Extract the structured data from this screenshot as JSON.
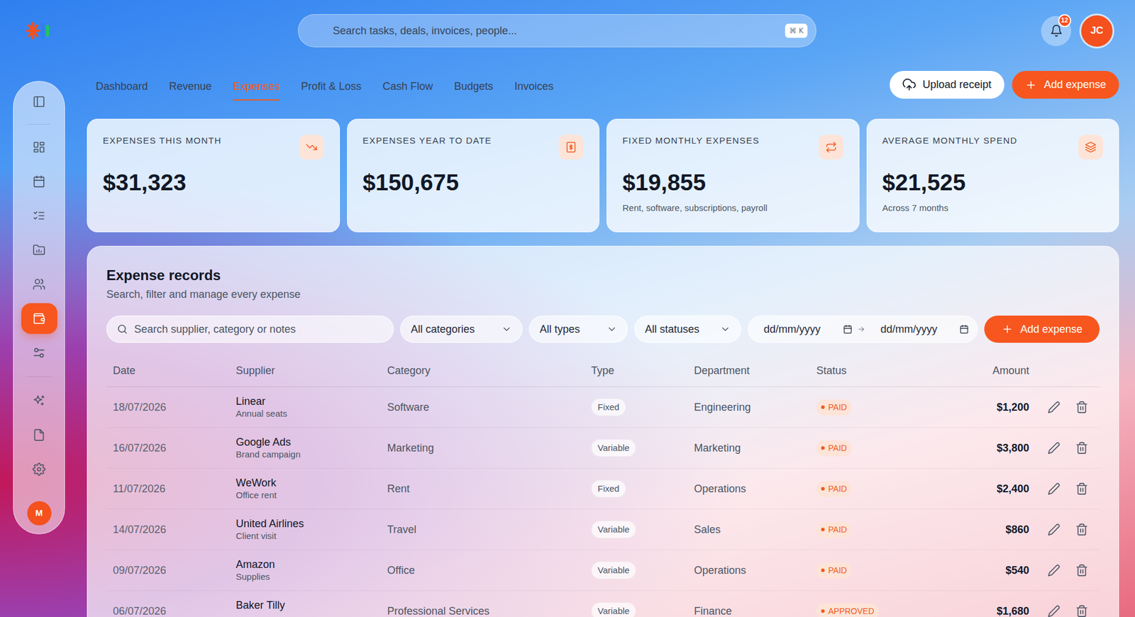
{
  "search": {
    "placeholder": "Search tasks, deals, invoices, people...",
    "shortcut": "⌘ K"
  },
  "notifications": {
    "count": "12"
  },
  "user": {
    "initials": "JC"
  },
  "sidebar": {
    "nav": [
      {
        "selected": false
      },
      {
        "selected": false
      },
      {
        "selected": false
      },
      {
        "selected": false
      },
      {
        "selected": false
      },
      {
        "selected": true
      },
      {
        "selected": false
      }
    ],
    "tools": [
      {
        "selected": false
      },
      {
        "selected": false
      },
      {
        "selected": false
      }
    ],
    "avatar": "M"
  },
  "tabs": [
    {
      "label": "Dashboard",
      "selected": false
    },
    {
      "label": "Revenue",
      "selected": false
    },
    {
      "label": "Expenses",
      "selected": true
    },
    {
      "label": "Profit & Loss",
      "selected": false
    },
    {
      "label": "Cash Flow",
      "selected": false
    },
    {
      "label": "Budgets",
      "selected": false
    },
    {
      "label": "Invoices",
      "selected": false
    }
  ],
  "actions": [
    {
      "label": "Upload receipt",
      "kind": "secondary"
    },
    {
      "label": "Add expense",
      "kind": "primary"
    }
  ],
  "stats": [
    {
      "label": "EXPENSES THIS MONTH",
      "value": "$31,323"
    },
    {
      "label": "EXPENSES YEAR TO DATE",
      "value": "$150,675"
    },
    {
      "label": "FIXED MONTHLY EXPENSES",
      "value": "$19,855",
      "note": "Rent, software, subscriptions, payroll"
    },
    {
      "label": "AVERAGE MONTHLY SPEND",
      "value": "$21,525",
      "note": "Across 7 months"
    }
  ],
  "records": {
    "title": "Expense records",
    "subtitle": "Search, filter and manage every expense",
    "search_placeholder": "Search supplier, category or notes",
    "filters": [
      "All categories",
      "All types",
      "All statuses"
    ],
    "date_from": "dd/mm/yyyy",
    "date_to": "dd/mm/yyyy",
    "add_label": "Add expense"
  },
  "table": {
    "columns": [
      "Date",
      "Supplier",
      "Category",
      "Type",
      "Department",
      "Status",
      "Amount"
    ],
    "rows": [
      {
        "date": "18/07/2026",
        "supplier": "Linear",
        "note": "Annual seats",
        "category": "Software",
        "type": "Fixed",
        "department": "Engineering",
        "status": "PAID",
        "amount": "$1,200"
      },
      {
        "date": "16/07/2026",
        "supplier": "Google Ads",
        "note": "Brand campaign",
        "category": "Marketing",
        "type": "Variable",
        "department": "Marketing",
        "status": "PAID",
        "amount": "$3,800"
      },
      {
        "date": "11/07/2026",
        "supplier": "WeWork",
        "note": "Office rent",
        "category": "Rent",
        "type": "Fixed",
        "department": "Operations",
        "status": "PAID",
        "amount": "$2,400"
      },
      {
        "date": "14/07/2026",
        "supplier": "United Airlines",
        "note": "Client visit",
        "category": "Travel",
        "type": "Variable",
        "department": "Sales",
        "status": "PAID",
        "amount": "$860"
      },
      {
        "date": "09/07/2026",
        "supplier": "Amazon",
        "note": "Supplies",
        "category": "Office",
        "type": "Variable",
        "department": "Operations",
        "status": "PAID",
        "amount": "$540"
      },
      {
        "date": "06/07/2026",
        "supplier": "Baker Tilly",
        "category": "Professional Services",
        "type": "Variable",
        "department": "Finance",
        "status": "APPROVED",
        "amount": "$1,680"
      }
    ]
  }
}
